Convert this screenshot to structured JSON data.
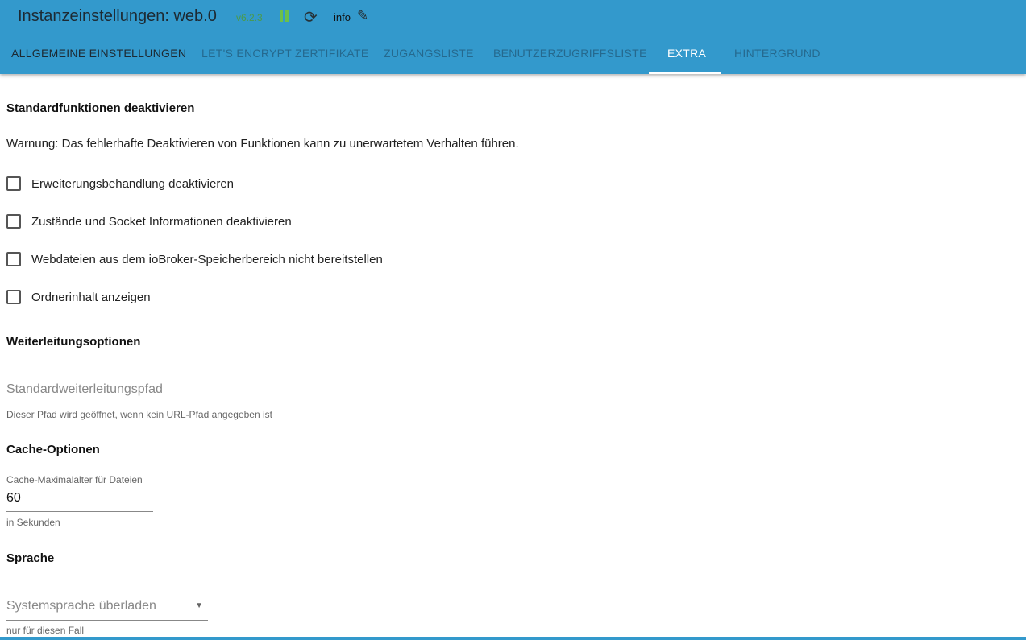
{
  "header": {
    "title": "Instanzeinstellungen: web.0",
    "version": "v6.2.3",
    "info": "info"
  },
  "tabs": [
    "ALLGEMEINE EINSTELLUNGEN",
    "LET'S ENCRYPT ZERTIFIKATE",
    "ZUGANGSLISTE",
    "BENUTZERZUGRIFFSLISTE",
    "EXTRA",
    "HINTERGRUND"
  ],
  "section1": {
    "title": "Standardfunktionen deaktivieren",
    "warning": "Warnung: Das fehlerhafte Deaktivieren von Funktionen kann zu unerwartetem Verhalten führen.",
    "checkboxes": [
      "Erweiterungsbehandlung deaktivieren",
      "Zustände und Socket Informationen deaktivieren",
      "Webdateien aus dem ioBroker-Speicherbereich nicht bereitstellen",
      "Ordnerinhalt anzeigen"
    ]
  },
  "section2": {
    "title": "Weiterleitungsoptionen",
    "placeholder": "Standardweiterleitungspfad",
    "help": "Dieser Pfad wird geöffnet, wenn kein URL-Pfad angegeben ist"
  },
  "section3": {
    "title": "Cache-Optionen",
    "label": "Cache-Maximalalter für Dateien",
    "value": "60",
    "help": "in Sekunden"
  },
  "section4": {
    "title": "Sprache",
    "placeholder": "Systemsprache überladen",
    "help": "nur für diesen Fall"
  }
}
